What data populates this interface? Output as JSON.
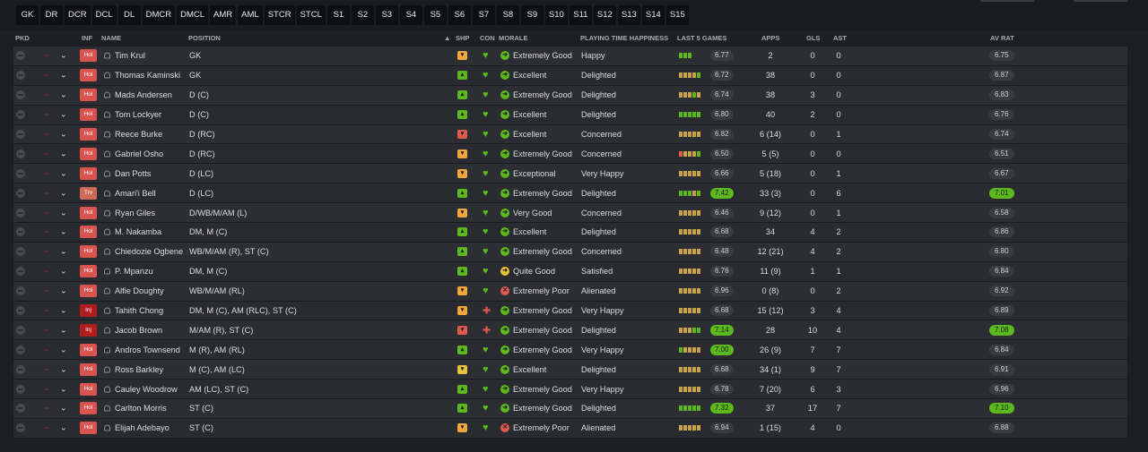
{
  "position_filters": [
    "GK",
    "DR",
    "DCR",
    "DCL",
    "DL",
    "DMCR",
    "DMCL",
    "AMR",
    "AML",
    "STCR",
    "STCL",
    "S1",
    "S2",
    "S3",
    "S4",
    "S5",
    "S6",
    "S7",
    "S8",
    "S9",
    "S10",
    "S11",
    "S12",
    "S13",
    "S14",
    "S15"
  ],
  "headers": {
    "pkd": "PKD",
    "inf": "INF",
    "name": "NAME",
    "position": "POSITION",
    "sort_arrow": "▲",
    "shp": "SHP",
    "con": "CON",
    "morale": "MORALE",
    "pth": "PLAYING TIME HAPPINESS",
    "last5": "LAST 5 GAMES",
    "apps": "APPS",
    "gls": "GLS",
    "ast": "AST",
    "avrat": "AV RAT"
  },
  "colors": {
    "green": "#5cb81f",
    "amber": "#f0a63a",
    "red": "#e05a4e",
    "yellow": "#e8c23a",
    "mid": "#c9a24a"
  },
  "players": [
    {
      "inf": "Hol",
      "name": "Tim Krul",
      "position": "GK",
      "shp": "amber",
      "morale": "Extremely Good",
      "morale_icon": "green",
      "pth": "Happy",
      "form": [
        "g",
        "g",
        "g"
      ],
      "form_rating": "6.77",
      "apps": "2",
      "gls": "0",
      "ast": "0",
      "av_rat": "6.75"
    },
    {
      "inf": "Hol",
      "name": "Thomas Kaminski",
      "position": "GK",
      "shp": "green",
      "morale": "Excellent",
      "morale_icon": "green",
      "pth": "Delighted",
      "form": [
        "m",
        "m",
        "m",
        "m",
        "g"
      ],
      "form_rating": "6.72",
      "apps": "38",
      "gls": "0",
      "ast": "0",
      "av_rat": "6.87"
    },
    {
      "inf": "Hol",
      "name": "Mads Andersen",
      "position": "D (C)",
      "shp": "green",
      "morale": "Extremely Good",
      "morale_icon": "green",
      "pth": "Delighted",
      "form": [
        "m",
        "m",
        "m",
        "g",
        "m"
      ],
      "form_rating": "6.74",
      "apps": "38",
      "gls": "3",
      "ast": "0",
      "av_rat": "6.83"
    },
    {
      "inf": "Hol",
      "name": "Tom Lockyer",
      "position": "D (C)",
      "shp": "green",
      "morale": "Excellent",
      "morale_icon": "green",
      "pth": "Delighted",
      "form": [
        "g",
        "g",
        "g",
        "g",
        "g"
      ],
      "form_rating": "6.80",
      "apps": "40",
      "gls": "2",
      "ast": "0",
      "av_rat": "6.76"
    },
    {
      "inf": "Hol",
      "name": "Reece Burke",
      "position": "D (RC)",
      "shp": "red",
      "morale": "Excellent",
      "morale_icon": "green",
      "pth": "Concerned",
      "form": [
        "m",
        "m",
        "m",
        "m",
        "m"
      ],
      "form_rating": "6.82",
      "apps": "6 (14)",
      "gls": "0",
      "ast": "1",
      "av_rat": "6.74"
    },
    {
      "inf": "Hol",
      "name": "Gabriel Osho",
      "position": "D (RC)",
      "shp": "amber",
      "morale": "Extremely Good",
      "morale_icon": "green",
      "pth": "Concerned",
      "form": [
        "r",
        "m",
        "m",
        "m",
        "g"
      ],
      "form_rating": "6.50",
      "apps": "5 (5)",
      "gls": "0",
      "ast": "0",
      "av_rat": "6.51"
    },
    {
      "inf": "Hol",
      "name": "Dan Potts",
      "position": "D (LC)",
      "shp": "amber",
      "morale": "Exceptional",
      "morale_icon": "green",
      "pth": "Very Happy",
      "form": [
        "m",
        "m",
        "m",
        "m",
        "m"
      ],
      "form_rating": "6.66",
      "apps": "5 (18)",
      "gls": "0",
      "ast": "1",
      "av_rat": "6.67"
    },
    {
      "inf": "Trv",
      "name": "Amari'i Bell",
      "position": "D (LC)",
      "shp": "green",
      "morale": "Extremely Good",
      "morale_icon": "green",
      "pth": "Delighted",
      "form": [
        "g",
        "g",
        "g",
        "m",
        "g"
      ],
      "form_rating": "7.42",
      "form_hi": true,
      "apps": "33 (3)",
      "gls": "0",
      "ast": "6",
      "av_rat": "7.01",
      "av_hi": true
    },
    {
      "inf": "Hol",
      "name": "Ryan Giles",
      "position": "D/WB/M/AM (L)",
      "shp": "amber",
      "morale": "Very Good",
      "morale_icon": "green",
      "pth": "Concerned",
      "form": [
        "m",
        "m",
        "m",
        "m",
        "m"
      ],
      "form_rating": "6.46",
      "apps": "9 (12)",
      "gls": "0",
      "ast": "1",
      "av_rat": "6.58"
    },
    {
      "inf": "Hol",
      "name": "M. Nakamba",
      "position": "DM, M (C)",
      "shp": "green",
      "morale": "Excellent",
      "morale_icon": "green",
      "pth": "Delighted",
      "form": [
        "m",
        "m",
        "m",
        "m",
        "m"
      ],
      "form_rating": "6.68",
      "apps": "34",
      "gls": "4",
      "ast": "2",
      "av_rat": "6.86"
    },
    {
      "inf": "Hol",
      "name": "Chiedozie Ogbene",
      "position": "WB/M/AM (R), ST (C)",
      "shp": "green",
      "morale": "Extremely Good",
      "morale_icon": "green",
      "pth": "Concerned",
      "form": [
        "m",
        "m",
        "m",
        "m",
        "m"
      ],
      "form_rating": "6.48",
      "apps": "12 (21)",
      "gls": "4",
      "ast": "2",
      "av_rat": "6.80"
    },
    {
      "inf": "Hol",
      "name": "P. Mpanzu",
      "position": "DM, M (C)",
      "shp": "green",
      "morale": "Quite Good",
      "morale_icon": "yellow",
      "pth": "Satisfied",
      "form": [
        "m",
        "m",
        "m",
        "m",
        "m"
      ],
      "form_rating": "6.76",
      "apps": "11 (9)",
      "gls": "1",
      "ast": "1",
      "av_rat": "6.84"
    },
    {
      "inf": "Hol",
      "name": "Alfie Doughty",
      "position": "WB/M/AM (RL)",
      "shp": "amber",
      "morale": "Extremely Poor",
      "morale_icon": "red",
      "pth": "Alienated",
      "form": [
        "m",
        "m",
        "m",
        "m",
        "m"
      ],
      "form_rating": "6.96",
      "apps": "0 (8)",
      "gls": "0",
      "ast": "2",
      "av_rat": "6.92"
    },
    {
      "inf": "Inj",
      "name": "Tahith Chong",
      "position": "DM, M (C), AM (RLC), ST (C)",
      "shp": "amber",
      "morale": "Extremely Good",
      "morale_icon": "green",
      "pth": "Very Happy",
      "form": [
        "m",
        "m",
        "m",
        "m",
        "m"
      ],
      "form_rating": "6.68",
      "apps": "15 (12)",
      "gls": "3",
      "ast": "4",
      "av_rat": "6.89"
    },
    {
      "inf": "Inj",
      "name": "Jacob Brown",
      "position": "M/AM (R), ST (C)",
      "shp": "red",
      "morale": "Extremely Good",
      "morale_icon": "green",
      "pth": "Delighted",
      "form": [
        "m",
        "m",
        "m",
        "g",
        "g"
      ],
      "form_rating": "7.14",
      "form_hi": true,
      "apps": "28",
      "gls": "10",
      "ast": "4",
      "av_rat": "7.08",
      "av_hi": true
    },
    {
      "inf": "Hol",
      "name": "Andros Townsend",
      "position": "M (R), AM (RL)",
      "shp": "green",
      "morale": "Extremely Good",
      "morale_icon": "green",
      "pth": "Very Happy",
      "form": [
        "g",
        "m",
        "m",
        "m",
        "m"
      ],
      "form_rating": "7.00",
      "form_hi": true,
      "apps": "26 (9)",
      "gls": "7",
      "ast": "7",
      "av_rat": "6.84"
    },
    {
      "inf": "Hol",
      "name": "Ross Barkley",
      "position": "M (C), AM (LC)",
      "shp": "yellow",
      "morale": "Excellent",
      "morale_icon": "green",
      "pth": "Delighted",
      "form": [
        "m",
        "m",
        "m",
        "m",
        "m"
      ],
      "form_rating": "6.68",
      "apps": "34 (1)",
      "gls": "9",
      "ast": "7",
      "av_rat": "6.91"
    },
    {
      "inf": "Hol",
      "name": "Cauley Woodrow",
      "position": "AM (LC), ST (C)",
      "shp": "green",
      "morale": "Extremely Good",
      "morale_icon": "green",
      "pth": "Very Happy",
      "form": [
        "m",
        "m",
        "m",
        "m",
        "m"
      ],
      "form_rating": "6.78",
      "apps": "7 (20)",
      "gls": "6",
      "ast": "3",
      "av_rat": "6.96"
    },
    {
      "inf": "Hol",
      "name": "Carlton Morris",
      "position": "ST (C)",
      "shp": "green",
      "morale": "Extremely Good",
      "morale_icon": "green",
      "pth": "Delighted",
      "form": [
        "g",
        "g",
        "g",
        "g",
        "g"
      ],
      "form_rating": "7.32",
      "form_hi": true,
      "apps": "37",
      "gls": "17",
      "ast": "7",
      "av_rat": "7.10",
      "av_hi": true
    },
    {
      "inf": "Hol",
      "name": "Elijah Adebayo",
      "position": "ST (C)",
      "shp": "amber",
      "morale": "Extremely Poor",
      "morale_icon": "red",
      "pth": "Alienated",
      "form": [
        "m",
        "m",
        "m",
        "m",
        "m"
      ],
      "form_rating": "6.94",
      "apps": "1 (15)",
      "gls": "4",
      "ast": "0",
      "av_rat": "6.88"
    }
  ]
}
